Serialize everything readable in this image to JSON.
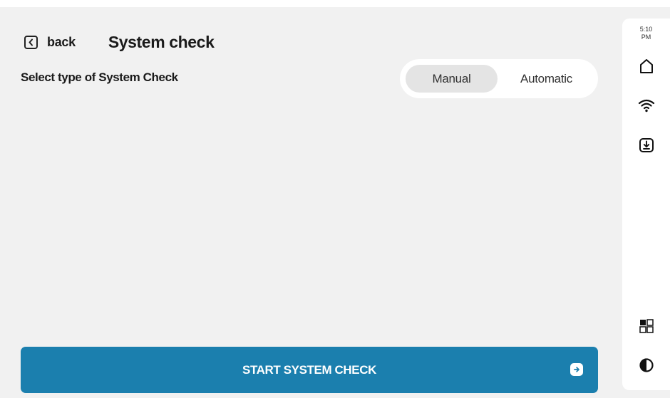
{
  "header": {
    "back_label": "back",
    "title": "System check"
  },
  "check_type": {
    "label": "Select type of System Check",
    "options": [
      "Manual",
      "Automatic"
    ],
    "selected": "Manual"
  },
  "start_button": {
    "label": "START SYSTEM CHECK",
    "icon": "arrow-right-icon"
  },
  "rail": {
    "time": "5:10",
    "ampm": "PM",
    "icons": [
      "home-icon",
      "wifi-icon",
      "download-icon",
      "grid-view-icon",
      "contrast-icon"
    ]
  },
  "colors": {
    "accent": "#1b7fae",
    "background": "#f1f1f1",
    "segment_selected": "#e4e4e4"
  }
}
